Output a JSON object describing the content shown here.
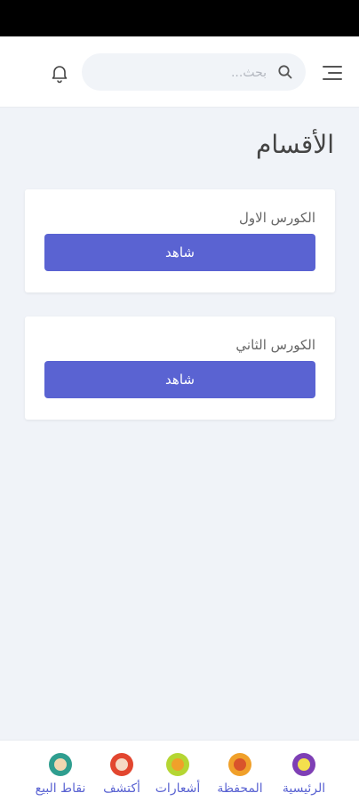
{
  "header": {
    "search_placeholder": "بحث...",
    "icons": {
      "menu": "menu-icon",
      "search": "search-icon",
      "notifications": "bell-icon"
    }
  },
  "page": {
    "title": "الأقسام"
  },
  "courses": [
    {
      "title": "الكورس الاول",
      "button_label": "شاهد"
    },
    {
      "title": "الكورس الثاني",
      "button_label": "شاهد"
    }
  ],
  "bottom_nav": {
    "items": [
      {
        "label": "الرئيسية",
        "icon": "home-icon",
        "color": "#7e3fb5"
      },
      {
        "label": "المحفظة",
        "icon": "wallet-icon",
        "color": "#f0a02a"
      },
      {
        "label": "أشعارات",
        "icon": "notifications-icon",
        "color": "#b5d633"
      },
      {
        "label": "أكتشف",
        "icon": "discover-icon",
        "color": "#e2462f"
      },
      {
        "label": "نقاط البيع",
        "icon": "points-of-sale-icon",
        "color": "#2f9e8f"
      }
    ]
  },
  "colors": {
    "accent": "#5a63d2",
    "background": "#f0f3f8"
  }
}
